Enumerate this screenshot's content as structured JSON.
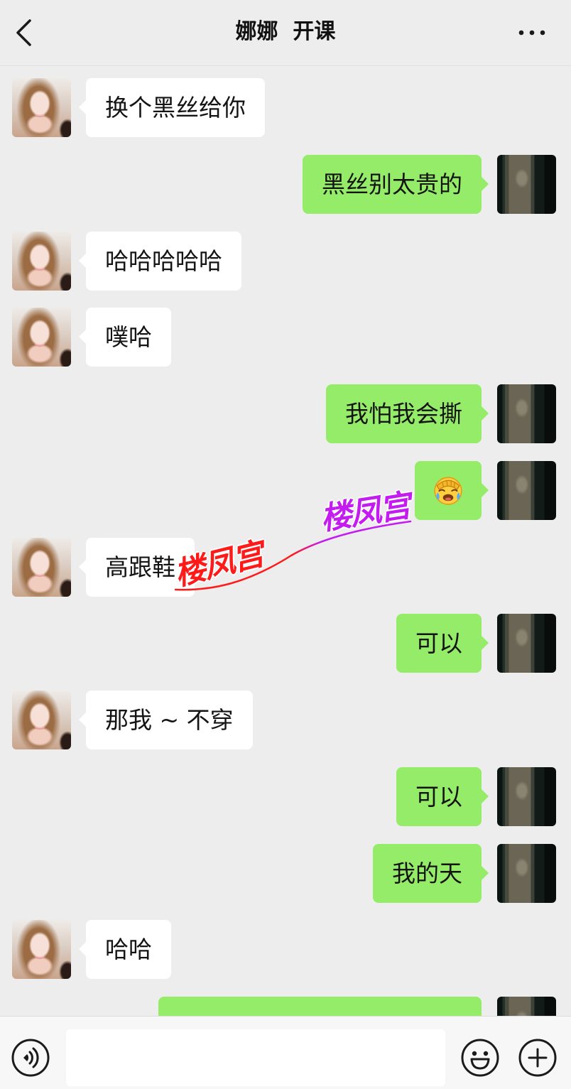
{
  "header": {
    "back_icon": "chevron-left-icon",
    "title": "娜娜  开课",
    "more_icon": "more-dots-icon"
  },
  "colors": {
    "page_background": "#ededed",
    "bubble_incoming": "#ffffff",
    "bubble_outgoing": "#95ec69",
    "input_bar_background": "#f7f7f7"
  },
  "messages": [
    {
      "outgoing": false,
      "text": "换个黑丝给你"
    },
    {
      "outgoing": true,
      "text": "黑丝别太贵的"
    },
    {
      "outgoing": false,
      "text": "哈哈哈哈哈"
    },
    {
      "outgoing": false,
      "text": "噗哈"
    },
    {
      "outgoing": true,
      "text": "我怕我会撕"
    },
    {
      "outgoing": true,
      "emoji_icon": "facepalm-emoji-icon"
    },
    {
      "outgoing": false,
      "text": "高跟鞋"
    },
    {
      "outgoing": true,
      "text": "可以"
    },
    {
      "outgoing": false,
      "text": "那我 ~ 不穿"
    },
    {
      "outgoing": true,
      "text": "可以"
    },
    {
      "outgoing": true,
      "text": "我的天"
    },
    {
      "outgoing": false,
      "text": "哈哈"
    },
    {
      "outgoing": true,
      "text": ""
    }
  ],
  "watermark": {
    "text_first": "楼凤宫",
    "text_second": "楼凤宫",
    "color_first": "#ff1a1a",
    "color_second": "#c41cf0"
  },
  "input_bar": {
    "voice_icon": "voice-icon",
    "value": "",
    "emoji_icon": "smiley-icon",
    "plus_icon": "plus-icon"
  }
}
